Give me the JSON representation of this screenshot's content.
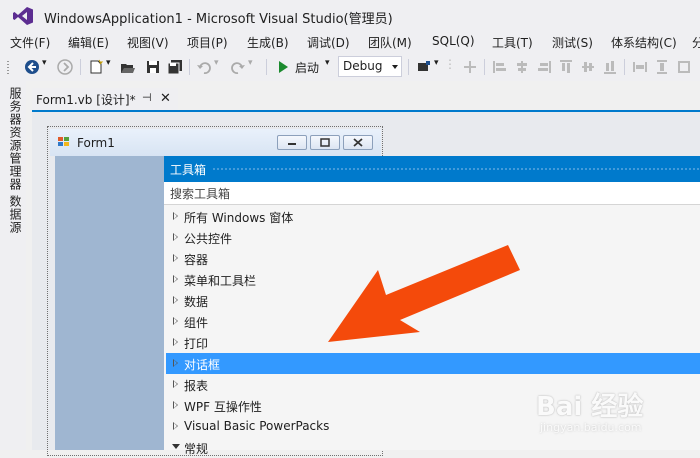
{
  "window": {
    "title": "WindowsApplication1 - Microsoft Visual Studio(管理员)"
  },
  "menu": [
    "文件(F)",
    "编辑(E)",
    "视图(V)",
    "项目(P)",
    "生成(B)",
    "调试(D)",
    "团队(M)",
    "SQL(Q)",
    "工具(T)",
    "测试(S)",
    "体系结构(C)",
    "分"
  ],
  "toolbar": {
    "start_label": "启动",
    "config_value": "Debug"
  },
  "side_tabs": [
    "服务器资源管理器",
    "数据源"
  ],
  "document_tab": {
    "label": "Form1.vb [设计]*",
    "pin": "⊣",
    "close": "✕"
  },
  "form": {
    "title": "Form1"
  },
  "toolbox": {
    "title": "工具箱",
    "search_placeholder": "搜索工具箱",
    "items": [
      "所有 Windows 窗体",
      "公共控件",
      "容器",
      "菜单和工具栏",
      "数据",
      "组件",
      "打印",
      "对话框",
      "报表",
      "WPF 互操作性",
      "Visual Basic PowerPacks",
      "常规"
    ],
    "selected": "对话框"
  },
  "annotation": {
    "color": "#f44a0b"
  },
  "watermark": {
    "text": "Bai 经验",
    "url": "jingyan.baidu.com"
  },
  "colors": {
    "accent": "#007acc",
    "selection": "#3399ff",
    "form_body": "#9fb6d1"
  }
}
